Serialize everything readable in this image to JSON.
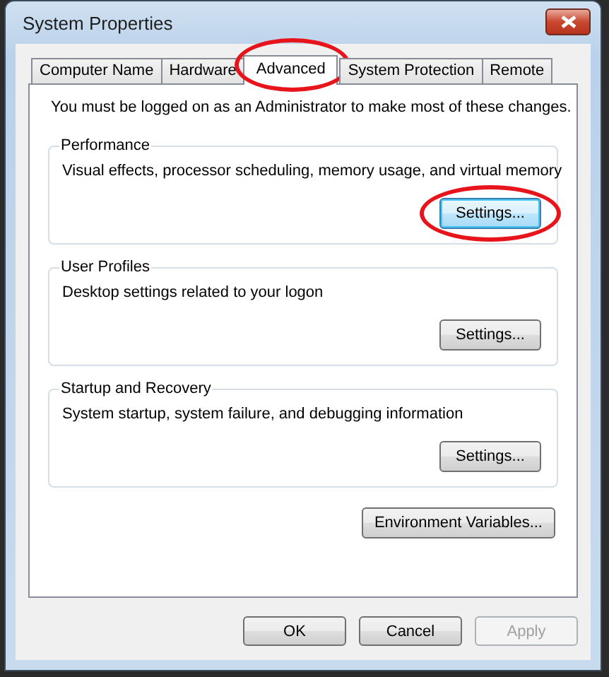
{
  "window": {
    "title": "System Properties"
  },
  "tabs": [
    {
      "label": "Computer Name",
      "selected": false,
      "highlighted": false
    },
    {
      "label": "Hardware",
      "selected": false,
      "highlighted": false
    },
    {
      "label": "Advanced",
      "selected": true,
      "highlighted": true
    },
    {
      "label": "System Protection",
      "selected": false,
      "highlighted": false
    },
    {
      "label": "Remote",
      "selected": false,
      "highlighted": false
    }
  ],
  "notice": "You must be logged on as an Administrator to make most of these changes.",
  "groups": [
    {
      "title": "Performance",
      "description": "Visual effects, processor scheduling, memory usage, and virtual memory",
      "button": {
        "label": "Settings...",
        "focused": true,
        "highlighted": true
      }
    },
    {
      "title": "User Profiles",
      "description": "Desktop settings related to your logon",
      "button": {
        "label": "Settings...",
        "focused": false,
        "highlighted": false
      }
    },
    {
      "title": "Startup and Recovery",
      "description": "System startup, system failure, and debugging information",
      "button": {
        "label": "Settings...",
        "focused": false,
        "highlighted": false
      }
    }
  ],
  "environment_button": "Environment Variables...",
  "buttons": [
    {
      "label": "OK",
      "disabled": false
    },
    {
      "label": "Cancel",
      "disabled": false
    },
    {
      "label": "Apply",
      "disabled": true
    }
  ]
}
